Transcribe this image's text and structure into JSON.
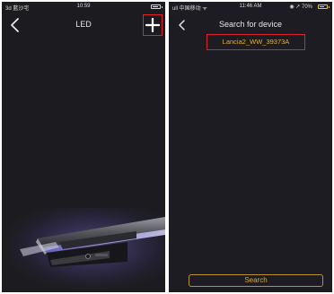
{
  "left_screen": {
    "status": {
      "carrier": "3d 藍沙宅",
      "time": "10:59",
      "battery_level": 0.85
    },
    "nav": {
      "title": "LED"
    },
    "icons": {
      "back": "chevron-left-icon",
      "add": "plus-icon"
    }
  },
  "right_screen": {
    "status": {
      "carrier": "ull 中国移动 ᯤ",
      "time": "11:46 AM",
      "right_info": "◉ ↗ 70%",
      "battery_level": 0.7
    },
    "nav": {
      "title": "Search for device"
    },
    "device_result": "Lancia2_WW_39373A",
    "search_button": "Search"
  },
  "colors": {
    "background": "#1c1c20",
    "highlight_red": "#d8232a",
    "gold_text": "#e2b23c",
    "title_text": "#e6e6e6"
  }
}
